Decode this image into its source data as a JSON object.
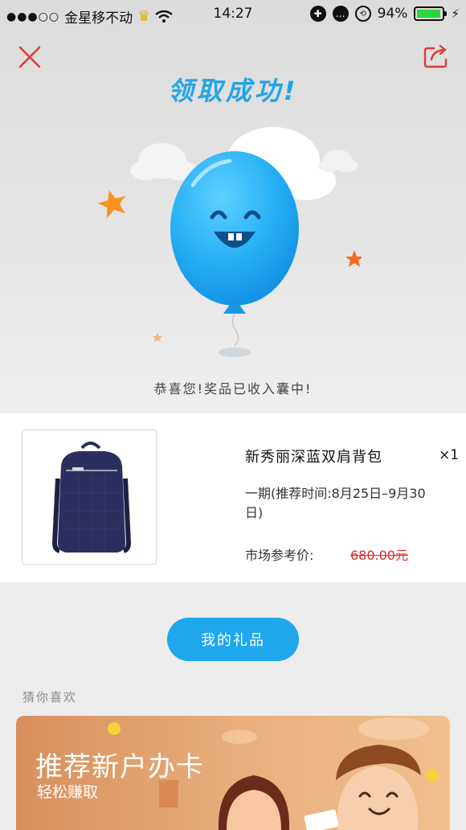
{
  "status_bar": {
    "carrier": "金星移不动",
    "time": "14:27",
    "battery": "94%",
    "battery_level": 0.94
  },
  "header": {
    "title": "领取成功!",
    "close_icon": "close-icon",
    "share_icon": "share-icon"
  },
  "hero": {
    "message": "恭喜您!奖品已收入囊中!"
  },
  "product": {
    "name": "新秀丽深蓝双肩背包",
    "quantity": "×1",
    "period": "一期(推荐时间:8月25日–9月30日)",
    "price_label": "市场参考价:",
    "price": "680.00元"
  },
  "actions": {
    "my_gifts": "我的礼品"
  },
  "recommend": {
    "title": "猜你喜欢",
    "banner_title": "推荐新户办卡",
    "banner_subtitle": "轻松赚取"
  },
  "colors": {
    "accent": "#1ea7ec",
    "close_red": "#e03a3a",
    "price_red": "#e02b2b",
    "balloon": "#29b6f6"
  }
}
